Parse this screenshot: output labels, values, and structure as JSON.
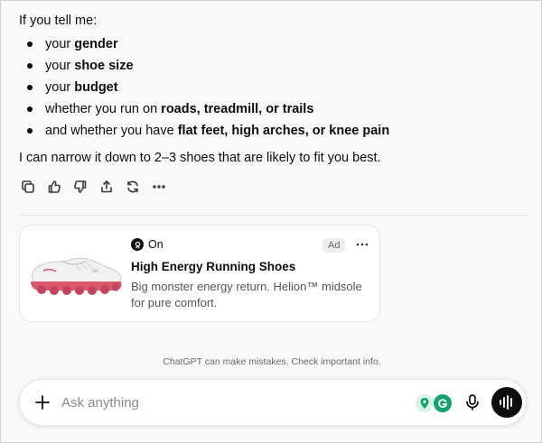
{
  "message": {
    "intro": "If you tell me:",
    "items": [
      {
        "pre": "your ",
        "bold": "gender",
        "post": ""
      },
      {
        "pre": "your ",
        "bold": "shoe size",
        "post": ""
      },
      {
        "pre": "your ",
        "bold": "budget",
        "post": ""
      },
      {
        "pre": "whether you run on ",
        "bold": "roads, treadmill, or trails",
        "post": ""
      },
      {
        "pre": "and whether you have ",
        "bold": "flat feet, high arches, or knee pain",
        "post": ""
      }
    ],
    "summary": "I can narrow it down to 2–3 shoes that are likely to fit you best."
  },
  "actions": [
    "copy-icon",
    "thumbs-up-icon",
    "thumbs-down-icon",
    "share-icon",
    "regenerate-icon",
    "more-icon"
  ],
  "ad": {
    "brand": "On",
    "badge": "Ad",
    "title": "High Energy Running Shoes",
    "description": "Big monster energy return. Helion™ midsole for pure comfort."
  },
  "disclaimer": "ChatGPT can make mistakes. Check important info.",
  "composer": {
    "placeholder": "Ask anything"
  },
  "colors": {
    "background": "#f9f9f9",
    "text": "#0d0d0d",
    "grammarly": "#12a36a",
    "shoe_sole": "#d9576f"
  }
}
